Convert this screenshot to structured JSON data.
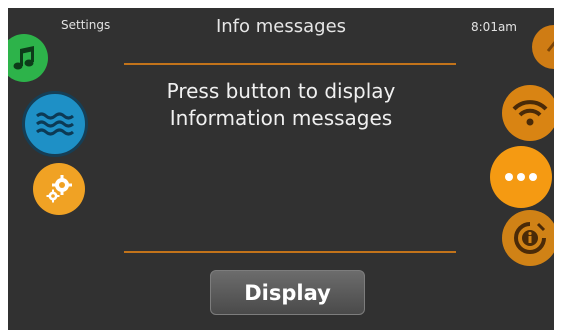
{
  "header": {
    "left_label": "Settings",
    "title": "Info messages",
    "time": "8:01am"
  },
  "message": {
    "line1": "Press button to display",
    "line2": "Information messages"
  },
  "display_button": {
    "label": "Display"
  },
  "left_icons": [
    {
      "name": "music-icon",
      "color": "#2db34a"
    },
    {
      "name": "water-icon",
      "color": "#1e90c6"
    },
    {
      "name": "gear-icon",
      "color": "#f0a224"
    }
  ],
  "right_icons": [
    {
      "name": "partial-icon",
      "color": "#cf7c14"
    },
    {
      "name": "wifi-icon",
      "color": "#d98413"
    },
    {
      "name": "more-icon",
      "color": "#f59a12",
      "selected": true
    },
    {
      "name": "info-icon",
      "color": "#d08216"
    }
  ],
  "colors": {
    "background": "#313131",
    "accent": "#c2731a",
    "text": "#f0f0f0"
  }
}
